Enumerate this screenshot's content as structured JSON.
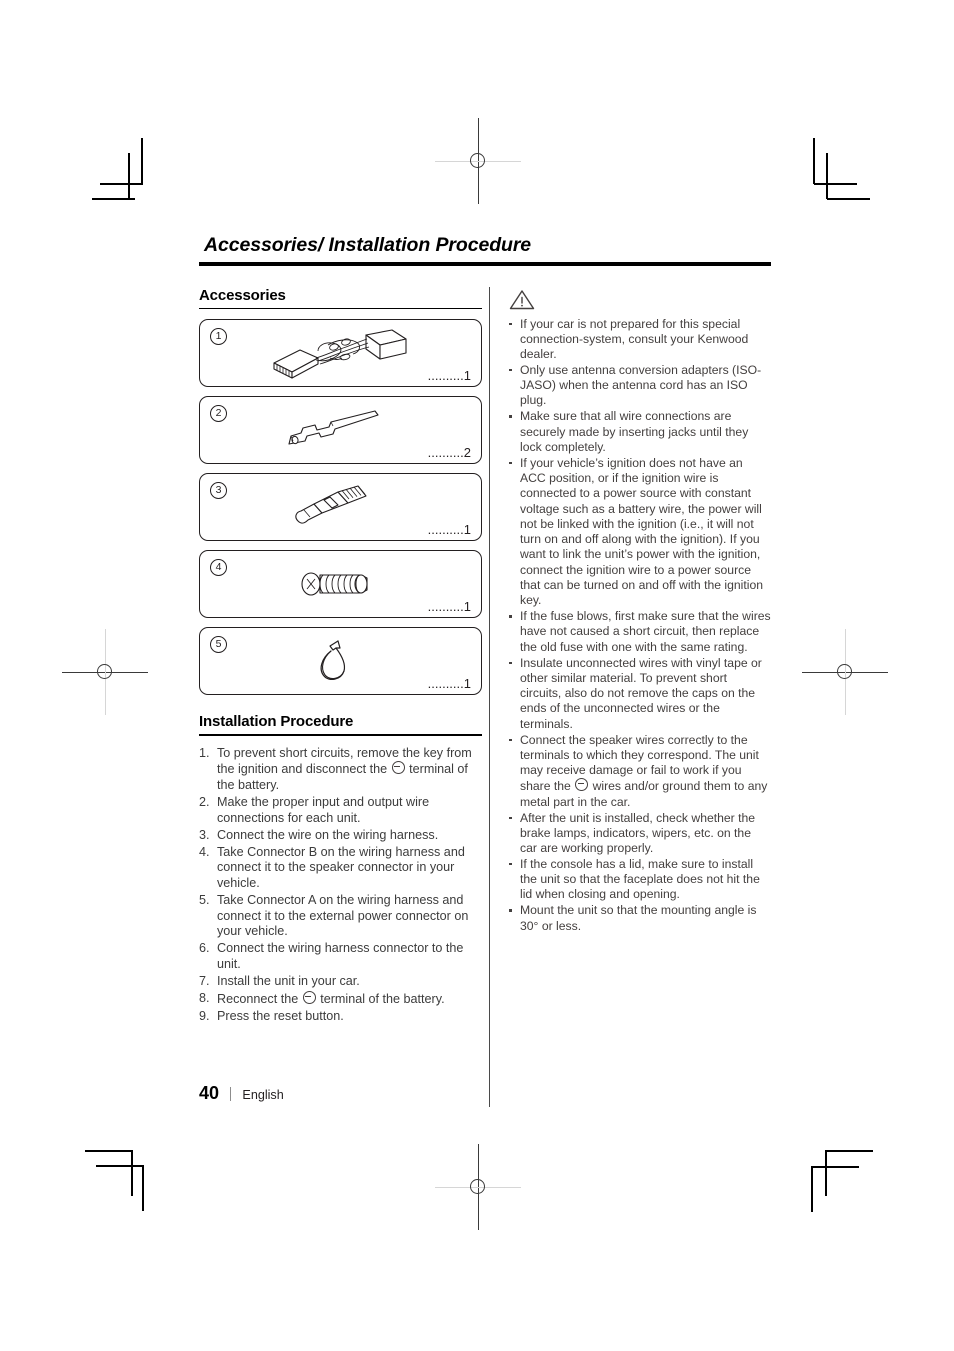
{
  "document": {
    "running_head": "Accessories/ Installation Procedure",
    "page_number": "40",
    "language": "English"
  },
  "accessories_section": {
    "heading": "Accessories",
    "items": [
      {
        "number": "1",
        "leader": "..........",
        "qty": "1",
        "art": "wiring-harness"
      },
      {
        "number": "2",
        "leader": "..........",
        "qty": "2",
        "art": "extraction-key"
      },
      {
        "number": "3",
        "leader": "..........",
        "qty": "1",
        "art": "antenna-adapter"
      },
      {
        "number": "4",
        "leader": "..........",
        "qty": "1",
        "art": "screw"
      },
      {
        "number": "5",
        "leader": "..........",
        "qty": "1",
        "art": "cable-tie"
      }
    ]
  },
  "installation_section": {
    "heading": "Installation Procedure",
    "steps": [
      {
        "n": "1.",
        "text_a": "To prevent short circuits, remove the key from the ignition and disconnect the ",
        "glyph": "minus-circle",
        "text_b": " terminal of the battery."
      },
      {
        "n": "2.",
        "text_a": "Make the proper input and output wire connections for each unit.",
        "glyph": "",
        "text_b": ""
      },
      {
        "n": "3.",
        "text_a": "Connect the wire on the wiring harness.",
        "glyph": "",
        "text_b": ""
      },
      {
        "n": "4.",
        "text_a": "Take Connector B on the wiring harness and connect it to the speaker connector in your vehicle.",
        "glyph": "",
        "text_b": ""
      },
      {
        "n": "5.",
        "text_a": "Take Connector A on the wiring harness and connect it to the external power connector on your vehicle.",
        "glyph": "",
        "text_b": ""
      },
      {
        "n": "6.",
        "text_a": "Connect the wiring harness connector to the unit.",
        "glyph": "",
        "text_b": ""
      },
      {
        "n": "7.",
        "text_a": "Install the unit in your car.",
        "glyph": "",
        "text_b": ""
      },
      {
        "n": "8.",
        "text_a": "Reconnect the ",
        "glyph": "minus-circle",
        "text_b": " terminal of the battery."
      },
      {
        "n": "9.",
        "text_a": "Press the reset button.",
        "glyph": "",
        "text_b": ""
      }
    ]
  },
  "warnings": {
    "icon": "warning-triangle-icon",
    "items": [
      {
        "text_a": "If your car is not prepared for this special connection-system, consult your Kenwood dealer.",
        "glyph": "",
        "text_b": ""
      },
      {
        "text_a": "Only use antenna conversion adapters (ISO-JASO) when the antenna cord has an ISO plug.",
        "glyph": "",
        "text_b": ""
      },
      {
        "text_a": "Make sure that all wire connections are securely made by inserting jacks until they lock completely.",
        "glyph": "",
        "text_b": ""
      },
      {
        "text_a": "If your vehicle’s ignition does not have an ACC position, or if the ignition wire is connected to a power source with constant voltage such as a battery wire, the power will not be linked with the ignition (i.e., it will not turn on and off along with the ignition). If you want to link the unit’s power with the ignition, connect the ignition wire to a power source that can be turned on and off with the ignition key.",
        "glyph": "",
        "text_b": ""
      },
      {
        "text_a": "If the fuse blows, first make sure that the wires have not caused a short circuit, then replace the old fuse with one with the same rating.",
        "glyph": "",
        "text_b": ""
      },
      {
        "text_a": "Insulate unconnected wires with vinyl tape or other similar material. To prevent short circuits, also do not remove the caps on the ends of the unconnected wires or the terminals.",
        "glyph": "",
        "text_b": ""
      },
      {
        "text_a": "Connect the speaker wires correctly to the terminals to which they correspond. The unit may receive damage or fail to work if you share the ",
        "glyph": "minus-circle",
        "text_b": " wires and/or ground them to any metal part in the car."
      },
      {
        "text_a": "After the unit is installed, check whether the brake lamps, indicators, wipers, etc. on the car are working properly.",
        "glyph": "",
        "text_b": ""
      },
      {
        "text_a": "If the console has a lid, make sure to install the unit so that the faceplate does not hit the lid when closing and opening.",
        "glyph": "",
        "text_b": ""
      },
      {
        "text_a": "Mount the unit so that the mounting angle is 30° or less.",
        "glyph": "",
        "text_b": ""
      }
    ]
  },
  "colors": {
    "rule": "#000000",
    "body_text": "#3c3c3c",
    "warn_text": "#44403f",
    "registration": "#3a3a3a"
  }
}
